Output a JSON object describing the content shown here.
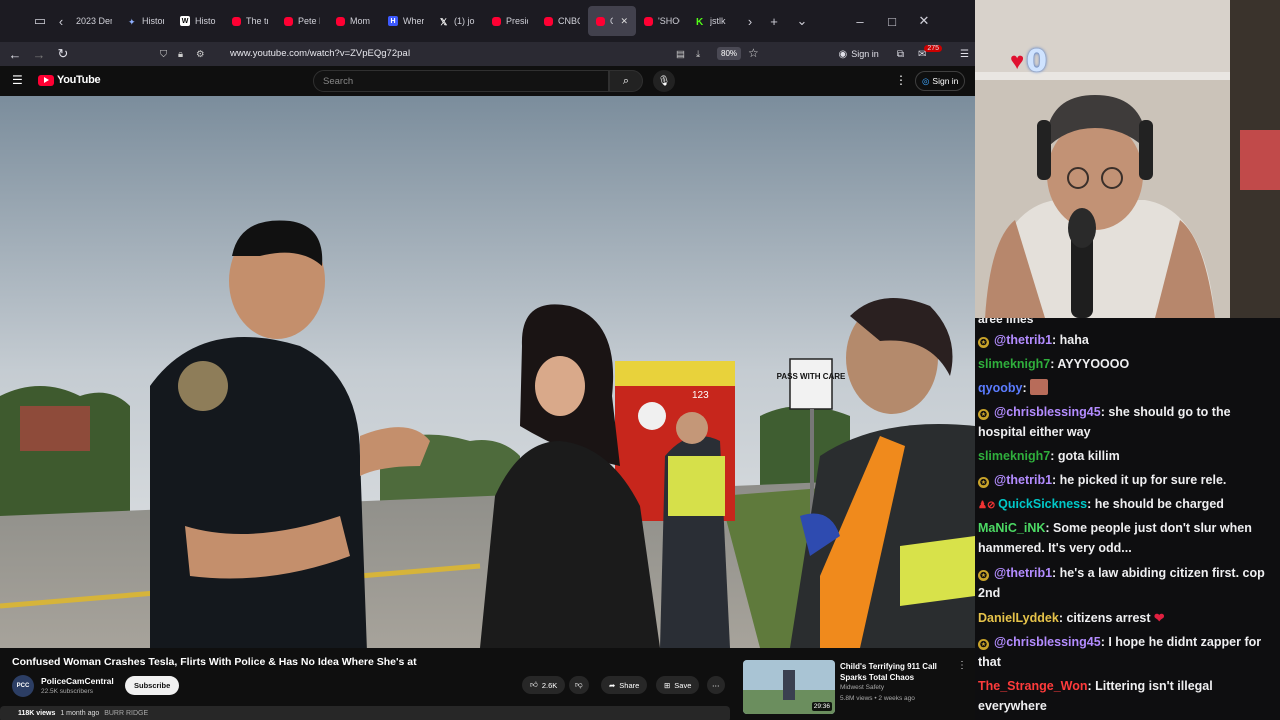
{
  "browser": {
    "tabs": [
      {
        "label": "2023 Dem",
        "fav": "none"
      },
      {
        "label": "Histor",
        "fav": "hist"
      },
      {
        "label": "Histor",
        "fav": "wiki"
      },
      {
        "label": "The tr",
        "fav": "yt"
      },
      {
        "label": "Pete H",
        "fav": "yt"
      },
      {
        "label": "Mom",
        "fav": "yt"
      },
      {
        "label": "Where",
        "fav": "h"
      },
      {
        "label": "(1) jo",
        "fav": "x"
      },
      {
        "label": "Presid",
        "fav": "yt"
      },
      {
        "label": "CNBC",
        "fav": "yt"
      },
      {
        "label": "Co",
        "fav": "yt",
        "active": true
      },
      {
        "label": "'SHOC",
        "fav": "yt"
      },
      {
        "label": "jstlk",
        "fav": "k"
      }
    ],
    "url": "www.youtube.com/watch?v=ZVpEQg72paI",
    "zoom": "80%",
    "signin_label": "Sign in",
    "notif_count": "275"
  },
  "youtube": {
    "logo_text": "YouTube",
    "search_placeholder": "Search",
    "signin_label": "Sign in",
    "video_title": "Confused Woman Crashes Tesla, Flirts With Police & Has No Idea Where She's at",
    "channel": {
      "name": "PoliceCamCentral",
      "subs": "22.5K subscribers",
      "avatar_text": "PCC"
    },
    "subscribe_label": "Subscribe",
    "likes": "2.6K",
    "share_label": "Share",
    "save_label": "Save",
    "views_prefix": "118K views",
    "views_age": "1 month ago",
    "views_tag": "BURR RIDGE",
    "video_overlay": {
      "sign_text": "PASS WITH CARE",
      "truck_number": "123"
    },
    "recommended": {
      "title": "Child's Terrifying 911 Call Sparks Total Chaos",
      "channel": "Midwest Safety",
      "meta": "5.8M views • 2 weeks ago",
      "duration": "29:36"
    }
  },
  "webcam": {
    "counter": "0"
  },
  "chat": {
    "cut_text": "aree lines",
    "messages": [
      {
        "user": "@thetrib1",
        "color": "#b38cff",
        "prime": true,
        "text": ": haha"
      },
      {
        "user": "slimeknigh7",
        "color": "#2fae3c",
        "prime": false,
        "text": ": AYYYOOOO"
      },
      {
        "user": "qyooby",
        "color": "#5b7cff",
        "prime": false,
        "text": ": ",
        "emote": true
      },
      {
        "user": "@chrisblessing45",
        "color": "#b38cff",
        "prime": true,
        "text": ": she should go to the hospital either way"
      },
      {
        "user": "slimeknigh7",
        "color": "#2fae3c",
        "prime": false,
        "text": ": gota killim"
      },
      {
        "user": "@thetrib1",
        "color": "#b38cff",
        "prime": true,
        "text": ": he picked it up for sure rele."
      },
      {
        "user": "QuickSickness",
        "color": "#00c8c8",
        "prime": false,
        "badges": true,
        "text": ": he should be charged"
      },
      {
        "user": "MaNiC_iNK",
        "color": "#4cd964",
        "prime": false,
        "text": ": Some people just don't slur when hammered. It's very odd..."
      },
      {
        "user": "@thetrib1",
        "color": "#b38cff",
        "prime": true,
        "text": ": he's a law abiding citizen first. cop 2nd"
      },
      {
        "user": "DanielLyddek",
        "color": "#e6c34a",
        "prime": false,
        "text": ": citizens arrest",
        "emote2": true
      },
      {
        "user": "@chrisblessing45",
        "color": "#b38cff",
        "prime": true,
        "text": ": I hope he didnt zapper for that"
      },
      {
        "user": "The_Strange_Won",
        "color": "#ff3b3b",
        "prime": false,
        "text": ": Littering isn't illegal everywhere"
      }
    ]
  },
  "colors": {
    "yt_red": "#ff0033",
    "chat_bg": "#0e0e10",
    "browser_tab_bg": "#1c1b22"
  }
}
